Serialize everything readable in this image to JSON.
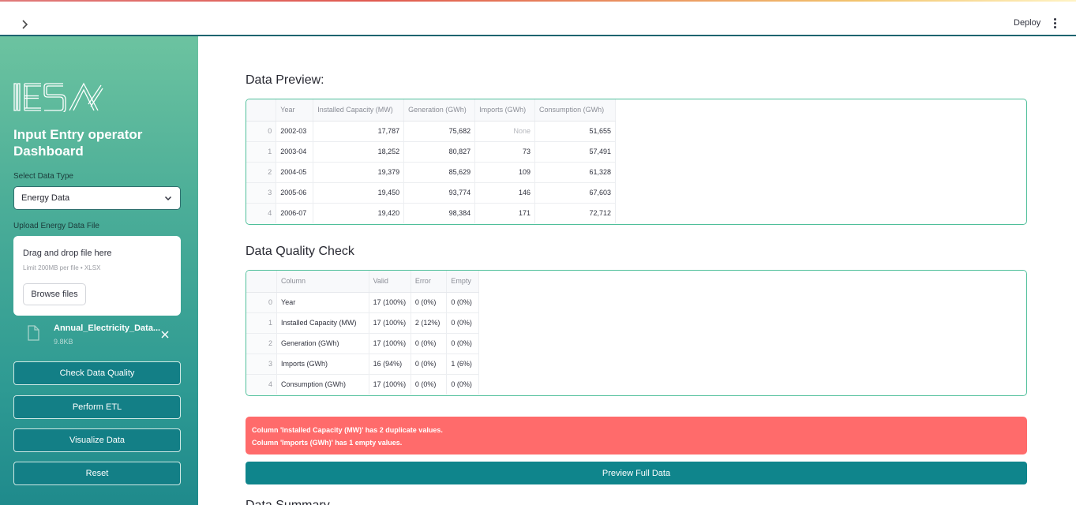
{
  "header": {
    "deploy_label": "Deploy"
  },
  "sidebar": {
    "title": "Input Entry operator Dashboard",
    "select_label": "Select Data Type",
    "select_value": "Energy Data",
    "upload_label": "Upload Energy Data File",
    "drag_title": "Drag and drop file here",
    "drag_limit": "Limit 200MB per file • XLSX",
    "browse_label": "Browse files",
    "file_name": "Annual_Electricity_Data...",
    "file_size": "9.8KB",
    "buttons": [
      "Check Data Quality",
      "Perform ETL",
      "Visualize Data",
      "Reset"
    ]
  },
  "preview": {
    "title": "Data Preview:",
    "columns": [
      "Year",
      "Installed Capacity (MW)",
      "Generation (GWh)",
      "Imports (GWh)",
      "Consumption (GWh)"
    ],
    "rows": [
      [
        "0",
        "2002-03",
        "17,787",
        "75,682",
        "None",
        "51,655"
      ],
      [
        "1",
        "2003-04",
        "18,252",
        "80,827",
        "73",
        "57,491"
      ],
      [
        "2",
        "2004-05",
        "19,379",
        "85,629",
        "109",
        "61,328"
      ],
      [
        "3",
        "2005-06",
        "19,450",
        "93,774",
        "146",
        "67,603"
      ],
      [
        "4",
        "2006-07",
        "19,420",
        "98,384",
        "171",
        "72,712"
      ]
    ]
  },
  "quality": {
    "title": "Data Quality Check",
    "columns": [
      "Column",
      "Valid",
      "Error",
      "Empty"
    ],
    "rows": [
      [
        "0",
        "Year",
        "17 (100%)",
        "0 (0%)",
        "0 (0%)"
      ],
      [
        "1",
        "Installed Capacity (MW)",
        "17 (100%)",
        "2 (12%)",
        "0 (0%)"
      ],
      [
        "2",
        "Generation (GWh)",
        "17 (100%)",
        "0 (0%)",
        "0 (0%)"
      ],
      [
        "3",
        "Imports (GWh)",
        "16 (94%)",
        "0 (0%)",
        "1 (6%)"
      ],
      [
        "4",
        "Consumption (GWh)",
        "17 (100%)",
        "0 (0%)",
        "0 (0%)"
      ]
    ]
  },
  "alert": {
    "line1": "Column 'Installed Capacity (MW)' has 2 duplicate values.",
    "line2": "Column 'Imports (GWh)' has 1 empty values."
  },
  "preview_full_label": "Preview Full Data",
  "next_section_title": "Data Summary"
}
